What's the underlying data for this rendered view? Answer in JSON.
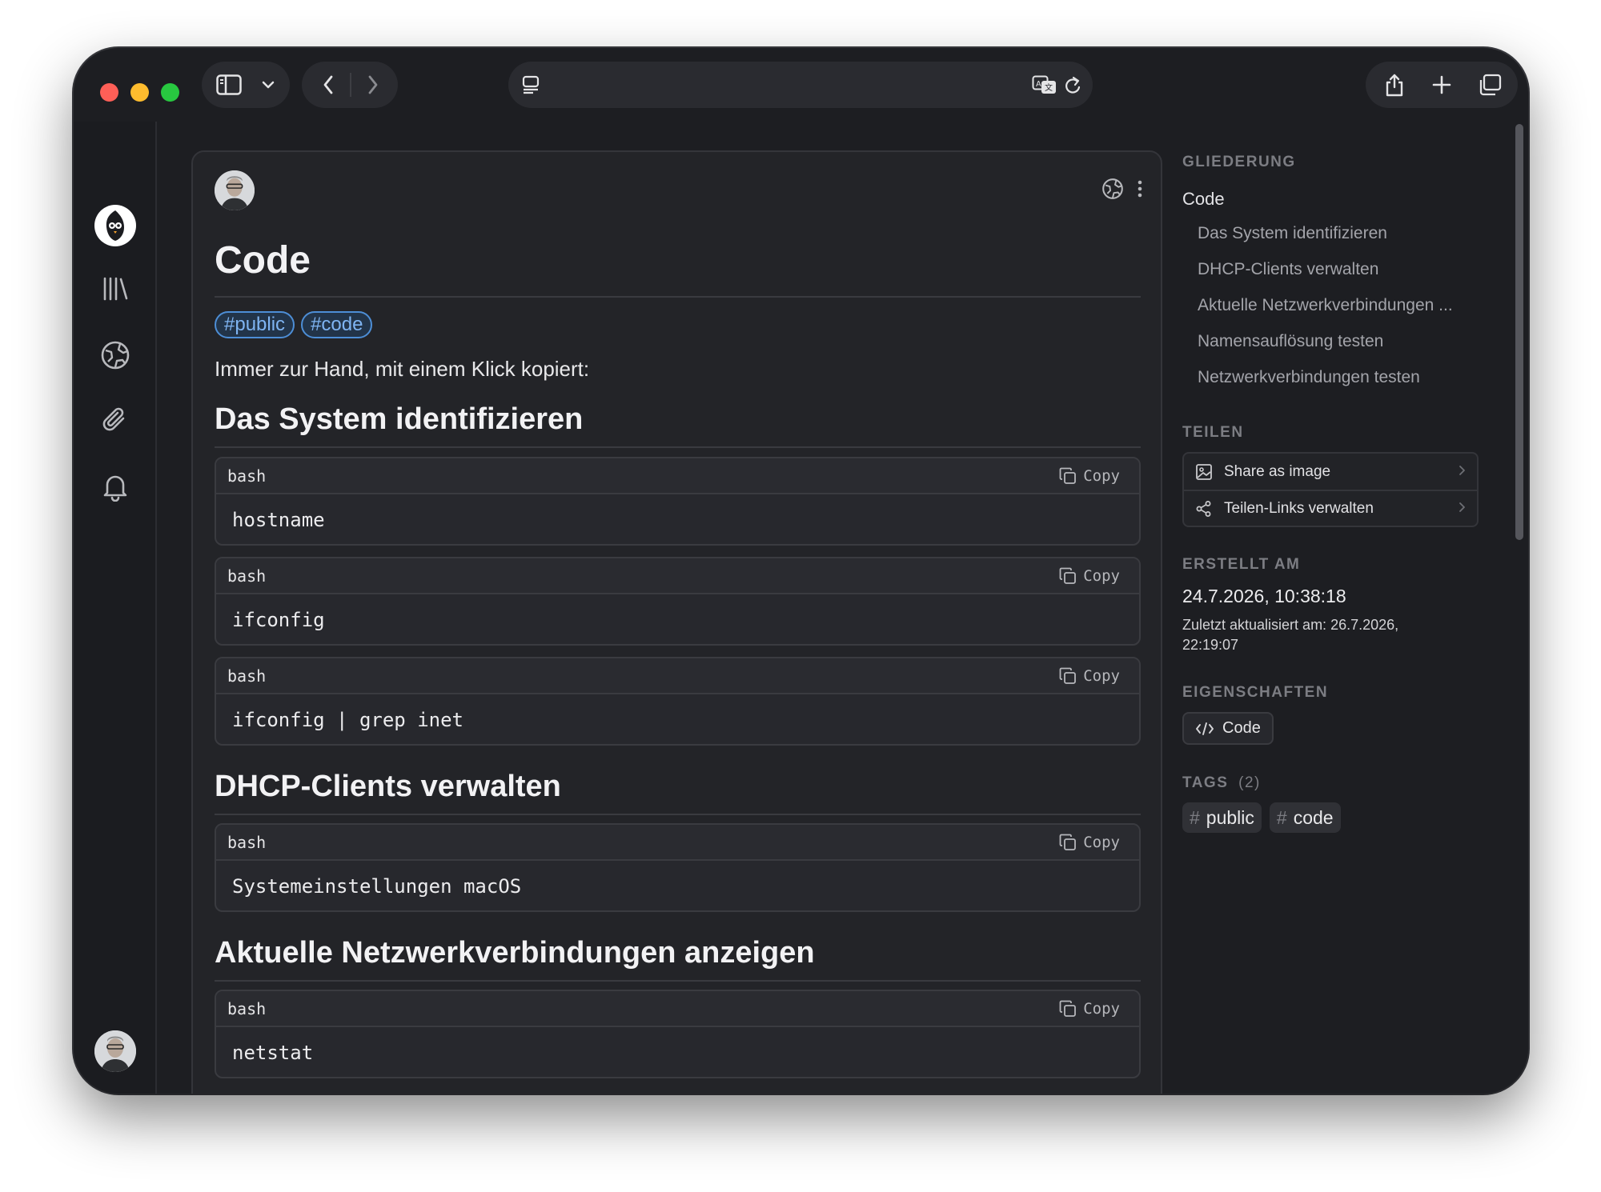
{
  "document": {
    "title": "Code",
    "tags": [
      "#public",
      "#code"
    ],
    "intro": "Immer zur Hand, mit einem Klick kopiert:",
    "sections": [
      {
        "heading": "Das System identifizieren"
      },
      {
        "heading": "DHCP-Clients verwalten"
      },
      {
        "heading": "Aktuelle Netzwerkverbindungen anzeigen"
      }
    ],
    "code_blocks": [
      {
        "lang": "bash",
        "copy_label": "Copy",
        "code": "hostname"
      },
      {
        "lang": "bash",
        "copy_label": "Copy",
        "code": "ifconfig"
      },
      {
        "lang": "bash",
        "copy_label": "Copy",
        "code": "ifconfig | grep inet"
      },
      {
        "lang": "bash",
        "copy_label": "Copy",
        "code": "Systemeinstellungen macOS"
      },
      {
        "lang": "bash",
        "copy_label": "Copy",
        "code": "netstat"
      }
    ]
  },
  "outline": {
    "label": "GLIEDERUNG",
    "top": "Code",
    "items": [
      "Das System identifizieren",
      "DHCP-Clients verwalten",
      "Aktuelle Netzwerkverbindungen ...",
      "Namensauflösung testen",
      "Netzwerkverbindungen testen"
    ]
  },
  "share": {
    "label": "TEILEN",
    "items": [
      "Share as image",
      "Teilen-Links verwalten"
    ]
  },
  "created": {
    "label": "ERSTELLT AM",
    "date": "24.7.2026, 10:38:18",
    "updated": "Zuletzt aktualisiert am: 26.7.2026, 22:19:07"
  },
  "properties": {
    "label": "EIGENSCHAFTEN",
    "type": "Code"
  },
  "tags_panel": {
    "label": "TAGS",
    "count": "(2)",
    "items": [
      "public",
      "code"
    ]
  },
  "colors": {
    "accent": "#4d8ed6",
    "background": "#1d1e22",
    "card": "#232428"
  }
}
